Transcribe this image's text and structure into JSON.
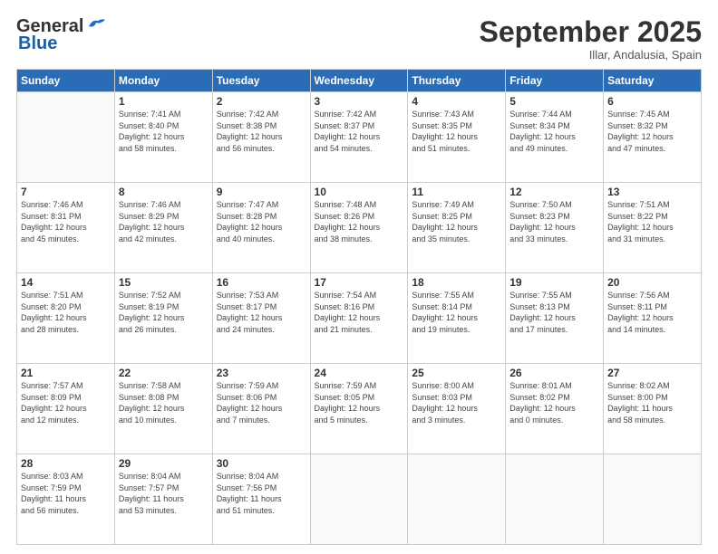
{
  "logo": {
    "general": "General",
    "blue": "Blue"
  },
  "header": {
    "month_title": "September 2025",
    "subtitle": "Illar, Andalusia, Spain"
  },
  "weekdays": [
    "Sunday",
    "Monday",
    "Tuesday",
    "Wednesday",
    "Thursday",
    "Friday",
    "Saturday"
  ],
  "weeks": [
    [
      {
        "day": "",
        "info": ""
      },
      {
        "day": "1",
        "info": "Sunrise: 7:41 AM\nSunset: 8:40 PM\nDaylight: 12 hours\nand 58 minutes."
      },
      {
        "day": "2",
        "info": "Sunrise: 7:42 AM\nSunset: 8:38 PM\nDaylight: 12 hours\nand 56 minutes."
      },
      {
        "day": "3",
        "info": "Sunrise: 7:42 AM\nSunset: 8:37 PM\nDaylight: 12 hours\nand 54 minutes."
      },
      {
        "day": "4",
        "info": "Sunrise: 7:43 AM\nSunset: 8:35 PM\nDaylight: 12 hours\nand 51 minutes."
      },
      {
        "day": "5",
        "info": "Sunrise: 7:44 AM\nSunset: 8:34 PM\nDaylight: 12 hours\nand 49 minutes."
      },
      {
        "day": "6",
        "info": "Sunrise: 7:45 AM\nSunset: 8:32 PM\nDaylight: 12 hours\nand 47 minutes."
      }
    ],
    [
      {
        "day": "7",
        "info": "Sunrise: 7:46 AM\nSunset: 8:31 PM\nDaylight: 12 hours\nand 45 minutes."
      },
      {
        "day": "8",
        "info": "Sunrise: 7:46 AM\nSunset: 8:29 PM\nDaylight: 12 hours\nand 42 minutes."
      },
      {
        "day": "9",
        "info": "Sunrise: 7:47 AM\nSunset: 8:28 PM\nDaylight: 12 hours\nand 40 minutes."
      },
      {
        "day": "10",
        "info": "Sunrise: 7:48 AM\nSunset: 8:26 PM\nDaylight: 12 hours\nand 38 minutes."
      },
      {
        "day": "11",
        "info": "Sunrise: 7:49 AM\nSunset: 8:25 PM\nDaylight: 12 hours\nand 35 minutes."
      },
      {
        "day": "12",
        "info": "Sunrise: 7:50 AM\nSunset: 8:23 PM\nDaylight: 12 hours\nand 33 minutes."
      },
      {
        "day": "13",
        "info": "Sunrise: 7:51 AM\nSunset: 8:22 PM\nDaylight: 12 hours\nand 31 minutes."
      }
    ],
    [
      {
        "day": "14",
        "info": "Sunrise: 7:51 AM\nSunset: 8:20 PM\nDaylight: 12 hours\nand 28 minutes."
      },
      {
        "day": "15",
        "info": "Sunrise: 7:52 AM\nSunset: 8:19 PM\nDaylight: 12 hours\nand 26 minutes."
      },
      {
        "day": "16",
        "info": "Sunrise: 7:53 AM\nSunset: 8:17 PM\nDaylight: 12 hours\nand 24 minutes."
      },
      {
        "day": "17",
        "info": "Sunrise: 7:54 AM\nSunset: 8:16 PM\nDaylight: 12 hours\nand 21 minutes."
      },
      {
        "day": "18",
        "info": "Sunrise: 7:55 AM\nSunset: 8:14 PM\nDaylight: 12 hours\nand 19 minutes."
      },
      {
        "day": "19",
        "info": "Sunrise: 7:55 AM\nSunset: 8:13 PM\nDaylight: 12 hours\nand 17 minutes."
      },
      {
        "day": "20",
        "info": "Sunrise: 7:56 AM\nSunset: 8:11 PM\nDaylight: 12 hours\nand 14 minutes."
      }
    ],
    [
      {
        "day": "21",
        "info": "Sunrise: 7:57 AM\nSunset: 8:09 PM\nDaylight: 12 hours\nand 12 minutes."
      },
      {
        "day": "22",
        "info": "Sunrise: 7:58 AM\nSunset: 8:08 PM\nDaylight: 12 hours\nand 10 minutes."
      },
      {
        "day": "23",
        "info": "Sunrise: 7:59 AM\nSunset: 8:06 PM\nDaylight: 12 hours\nand 7 minutes."
      },
      {
        "day": "24",
        "info": "Sunrise: 7:59 AM\nSunset: 8:05 PM\nDaylight: 12 hours\nand 5 minutes."
      },
      {
        "day": "25",
        "info": "Sunrise: 8:00 AM\nSunset: 8:03 PM\nDaylight: 12 hours\nand 3 minutes."
      },
      {
        "day": "26",
        "info": "Sunrise: 8:01 AM\nSunset: 8:02 PM\nDaylight: 12 hours\nand 0 minutes."
      },
      {
        "day": "27",
        "info": "Sunrise: 8:02 AM\nSunset: 8:00 PM\nDaylight: 11 hours\nand 58 minutes."
      }
    ],
    [
      {
        "day": "28",
        "info": "Sunrise: 8:03 AM\nSunset: 7:59 PM\nDaylight: 11 hours\nand 56 minutes."
      },
      {
        "day": "29",
        "info": "Sunrise: 8:04 AM\nSunset: 7:57 PM\nDaylight: 11 hours\nand 53 minutes."
      },
      {
        "day": "30",
        "info": "Sunrise: 8:04 AM\nSunset: 7:56 PM\nDaylight: 11 hours\nand 51 minutes."
      },
      {
        "day": "",
        "info": ""
      },
      {
        "day": "",
        "info": ""
      },
      {
        "day": "",
        "info": ""
      },
      {
        "day": "",
        "info": ""
      }
    ]
  ]
}
